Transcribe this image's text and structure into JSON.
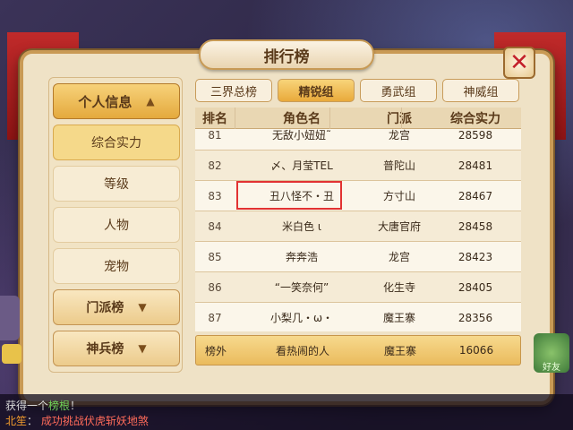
{
  "window": {
    "title": "排行榜",
    "close_label": "✕"
  },
  "sidebar": {
    "personal_info": "个人信息",
    "items": [
      "综合实力",
      "等级",
      "人物",
      "宠物"
    ],
    "sect_rank": "门派榜",
    "weapon_rank": "神兵榜"
  },
  "tabs": [
    "三界总榜",
    "精锐组",
    "勇武组",
    "神威组"
  ],
  "table": {
    "headers": [
      "排名",
      "角色名",
      "门派",
      "综合实力"
    ],
    "rows": [
      [
        "81",
        "无敌小妞妞˜",
        "龙宫",
        "28598"
      ],
      [
        "82",
        "〆、月莹TEL",
        "普陀山",
        "28481"
      ],
      [
        "83",
        "丑八怪不・丑",
        "方寸山",
        "28467"
      ],
      [
        "84",
        "米白色 ι",
        "大唐官府",
        "28458"
      ],
      [
        "85",
        "奔奔浩",
        "龙宫",
        "28423"
      ],
      [
        "86",
        "“一笑奈何”",
        "化生寺",
        "28405"
      ],
      [
        "87",
        "小梨几・ω・",
        "魔王寨",
        "28356"
      ]
    ],
    "footer": [
      "榜外",
      "看热闹的人",
      "魔王寨",
      "16066"
    ]
  },
  "hud": {
    "chat_line1_prefix": "获得一个",
    "chat_line1_item": "榜根",
    "chat_line1_suffix": "！",
    "chat_line2_name": "北笙",
    "chat_line2_text": "成功挑战伏虎斩妖地煞",
    "right_label": "好友"
  },
  "colors": {
    "highlight": "#e23232",
    "accent": "#e9aa3b"
  }
}
